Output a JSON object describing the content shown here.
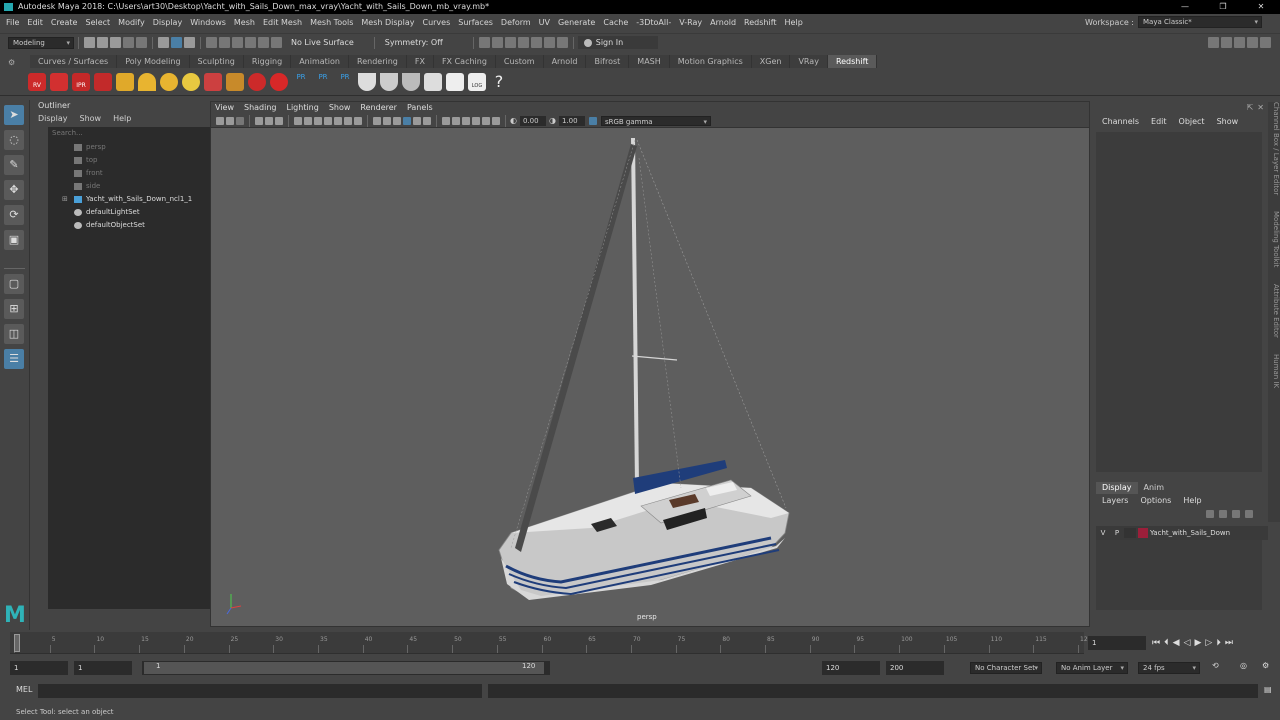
{
  "window": {
    "title": "Autodesk Maya 2018: C:\\Users\\art30\\Desktop\\Yacht_with_Sails_Down_max_vray\\Yacht_with_Sails_Down_mb_vray.mb*",
    "controls": [
      "—",
      "❐",
      "✕"
    ]
  },
  "menubar": {
    "items": [
      "File",
      "Edit",
      "Create",
      "Select",
      "Modify",
      "Display",
      "Windows",
      "Mesh",
      "Edit Mesh",
      "Mesh Tools",
      "Mesh Display",
      "Curves",
      "Surfaces",
      "Deform",
      "UV",
      "Generate",
      "Cache",
      "-3DtoAll-",
      "V-Ray",
      "Arnold",
      "Redshift",
      "Help"
    ],
    "workspace_label": "Workspace :",
    "workspace_value": "Maya Classic*"
  },
  "statusline": {
    "mode": "Modeling",
    "live_surface": "No Live Surface",
    "symmetry": "Symmetry: Off",
    "sign_in": "Sign In"
  },
  "shelf": {
    "tabs": [
      "Curves / Surfaces",
      "Poly Modeling",
      "Sculpting",
      "Rigging",
      "Animation",
      "Rendering",
      "FX",
      "FX Caching",
      "Custom",
      "Arnold",
      "Bifrost",
      "MASH",
      "Motion Graphics",
      "XGen",
      "VRay",
      "Redshift"
    ],
    "active_tab": "Redshift",
    "icon_labels": [
      "RV",
      "IPR",
      "PR",
      "PR",
      "PR",
      "LOG",
      "?"
    ]
  },
  "outliner": {
    "title": "Outliner",
    "menu": [
      "Display",
      "Show",
      "Help"
    ],
    "search_placeholder": "Search...",
    "items": [
      {
        "label": "persp",
        "type": "camera"
      },
      {
        "label": "top",
        "type": "camera"
      },
      {
        "label": "front",
        "type": "camera"
      },
      {
        "label": "side",
        "type": "camera"
      },
      {
        "label": "Yacht_with_Sails_Down_ncl1_1",
        "type": "group"
      },
      {
        "label": "defaultLightSet",
        "type": "set"
      },
      {
        "label": "defaultObjectSet",
        "type": "set"
      }
    ]
  },
  "viewport": {
    "menu": [
      "View",
      "Shading",
      "Lighting",
      "Show",
      "Renderer",
      "Panels"
    ],
    "exposure": "0.00",
    "gamma": "1.00",
    "color_space": "sRGB gamma",
    "camera_label": "persp"
  },
  "channelbox": {
    "menu": [
      "Channels",
      "Edit",
      "Object",
      "Show"
    ],
    "tabs": [
      "Display",
      "Anim"
    ],
    "active_tab": "Display",
    "layer_menu": [
      "Layers",
      "Options",
      "Help"
    ],
    "layer": {
      "v": "V",
      "p": "P",
      "name": "Yacht_with_Sails_Down",
      "color": "#9b1f3a"
    }
  },
  "side_tabs": [
    "Channel Box / Layer Editor",
    "Modeling Toolkit",
    "Attribute Editor",
    "Human IK"
  ],
  "timeline": {
    "ticks": [
      "1",
      "5",
      "10",
      "15",
      "20",
      "25",
      "30",
      "35",
      "40",
      "45",
      "50",
      "55",
      "60",
      "65",
      "70",
      "75",
      "80",
      "85",
      "90",
      "95",
      "100",
      "105",
      "110",
      "115",
      "120"
    ],
    "current_frame": "1"
  },
  "range": {
    "start": "1",
    "playback_start": "1",
    "slider_start": "1",
    "slider_end": "120",
    "playback_end": "120",
    "end": "200",
    "character_set": "No Character Set",
    "anim_layer": "No Anim Layer",
    "fps": "24 fps"
  },
  "command": {
    "label": "MEL"
  },
  "help_line": "Select Tool: select an object"
}
